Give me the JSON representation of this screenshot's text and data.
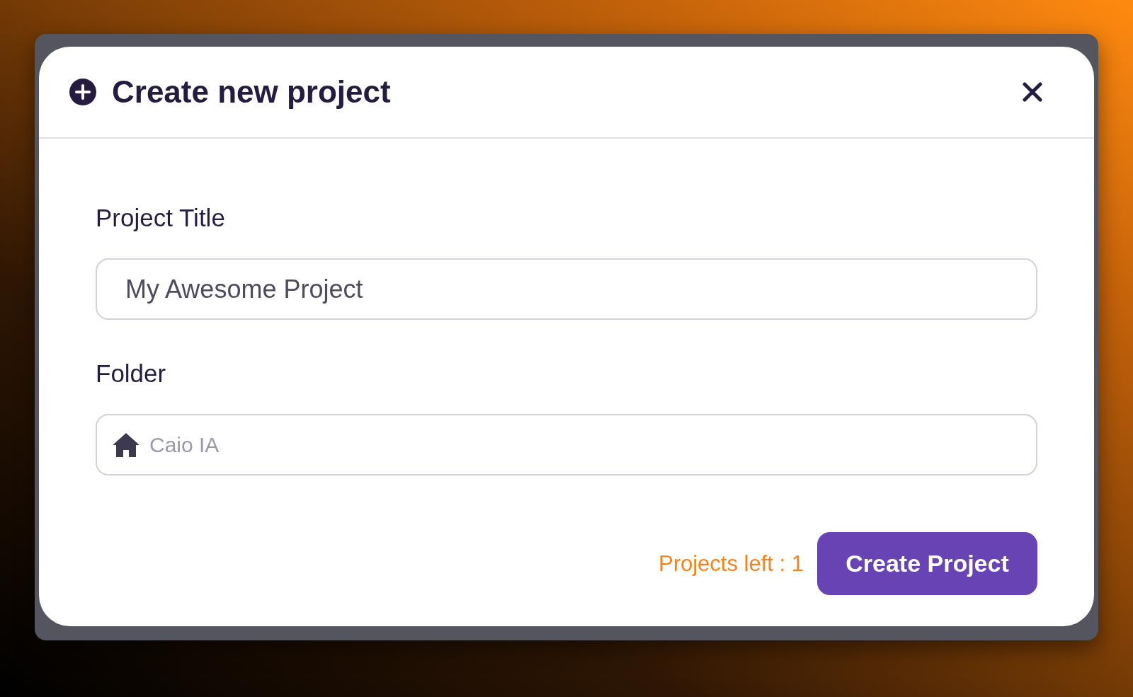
{
  "dialog": {
    "title": "Create new project",
    "fields": [
      {
        "kind": "text",
        "label": "Project Title",
        "value": "My Awesome Project"
      },
      {
        "kind": "folder",
        "label": "Folder",
        "value": "Caio IA"
      }
    ],
    "footer": {
      "projects_left": "Projects left : 1",
      "button": "Create Project"
    }
  }
}
